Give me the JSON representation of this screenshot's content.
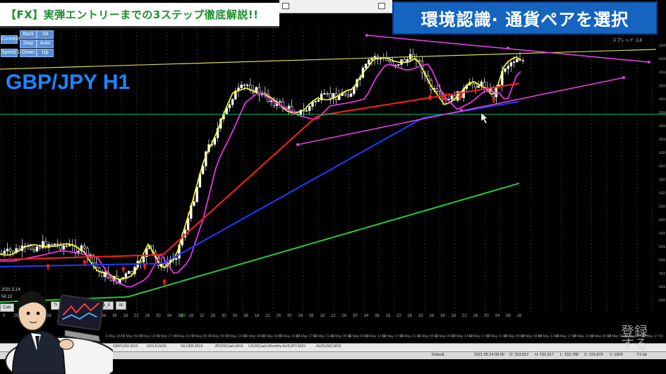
{
  "header": {
    "video_title": "【FX】実弾エントリーまでの3ステップ徹底解説!!",
    "topic": "環境認識· 通貨ペアを選択",
    "pair_label": "GBP/JPY H1"
  },
  "controls": {
    "row1": [
      "Connect",
      "Back",
      "Sit"
    ],
    "row2": [
      "Stop",
      "Auto"
    ],
    "row3": [
      "Speed:1",
      "Down",
      "Up"
    ]
  },
  "price_axis": {
    "ticks": [
      "154",
      "154",
      "153",
      "153",
      "153",
      "153",
      "153",
      "153",
      "152",
      "152",
      "152",
      "152",
      "152",
      "152",
      "151",
      "151",
      "151",
      "151",
      "151",
      "151"
    ]
  },
  "time_axis": {
    "ticks": [
      "0",
      "26",
      "30",
      "34",
      "38",
      "18",
      "22",
      "26",
      "30",
      "34",
      "38",
      "18",
      "22",
      "26",
      "30",
      "34",
      "38",
      "18",
      "22",
      "26",
      "30",
      "34",
      "38",
      "18",
      "22",
      "26",
      "30",
      "34",
      "38",
      "18",
      "22",
      "26",
      "30",
      "34",
      "38",
      "18",
      "22",
      "26",
      "30",
      "34",
      "38",
      "18",
      "22",
      "26",
      "30",
      "34",
      "38",
      "18"
    ],
    "highlight_tick": "20",
    "dates": [
      "6 May 2021",
      "6 May 09:00",
      "6 May 13:00",
      "6 May 17:00",
      "6 May 21:00",
      "7 May 05:00",
      "7 May 09:00",
      "7 May 13:00",
      "10 May 05:00",
      "10 May 09:00",
      "10 May 13:00",
      "10 May 17:00",
      "10 May 21:00",
      "11 May 05:00",
      "11 May 09:00",
      "11 May 13:00",
      "11 May 17:00",
      "11 May 21:00",
      "12 May 05:00",
      "12 May 09:00",
      "12 May 13:00",
      "12 May 17:00",
      "12 May 21:00",
      "13 May 05:00",
      "13 May 09:00",
      "13 May 13:00",
      "13 May 17:00",
      "13 May 21:00",
      "14 May 05:00",
      "14 May 09:00",
      "14 May 13:00",
      "14 May 17:00"
    ]
  },
  "tabs": [
    "GBPUSD,M15",
    "GOLD,M15",
    "SILVER,M15",
    "JP225Cash,M15",
    "US30Cash,Monthly",
    "AUDJPY,M15",
    "AUDUSD,M15"
  ],
  "mini_tabs": [
    "Tr",
    "Calc",
    "Ba_E",
    "All"
  ],
  "side_text": [
    "2021.5.14",
    "54.13"
  ],
  "status": {
    "profile": "Default",
    "datetime": "2021.05.14 08:00",
    "open": "O: 153,812",
    "high": "H: 153,917",
    "low": "L: 153,788",
    "close": "C: 153,876",
    "volume": "V: 1809",
    "traffic": "7/1 kb"
  },
  "corner_label": "スプレッド: 1.8",
  "register_label": "登録する",
  "colors": {
    "ma_fast": "#ffff33",
    "ma_20": "#ff33ff",
    "ma_50": "#ff2020",
    "ma_100": "#1f3dff",
    "ma_200": "#22cc33",
    "trendline": "#e040e0",
    "resistance": "#d8d84a",
    "support": "#00cc66",
    "bull_candle": "#ffffff",
    "bear_candle": "#ffffff",
    "signal_arrow": "#ff2020",
    "topic_bg": "#1565c0",
    "pair_label": "#1d86ff",
    "title_text": "#1b8f2c"
  }
}
